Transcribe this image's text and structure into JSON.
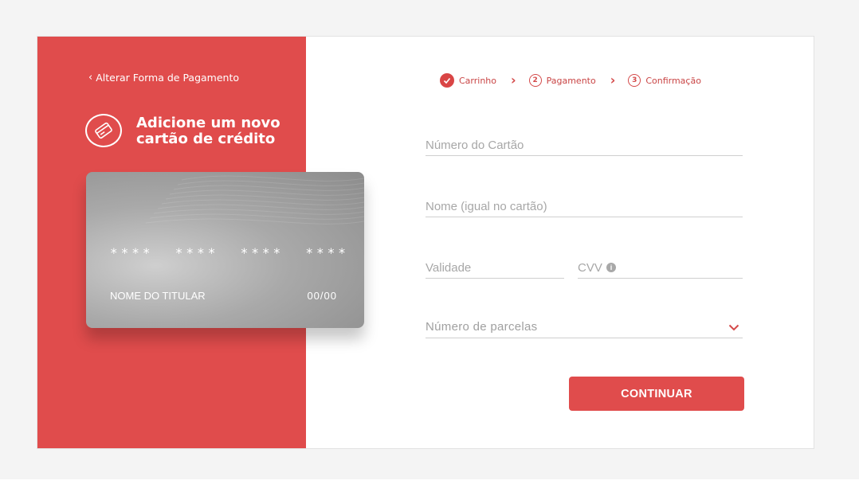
{
  "back_link": {
    "label": "Alterar Forma de Pagamento"
  },
  "header": {
    "title_line1": "Adicione um novo",
    "title_line2": "cartão de crédito"
  },
  "card": {
    "number": "****  ****  ****  ****",
    "holder": "NOME DO TITULAR",
    "expiry": "00/00"
  },
  "steps": [
    {
      "label": "Carrinho",
      "number": "",
      "status": "done"
    },
    {
      "label": "Pagamento",
      "number": "2",
      "status": "current"
    },
    {
      "label": "Confirmação",
      "number": "3",
      "status": "pending"
    }
  ],
  "form": {
    "card_number_placeholder": "Número do Cartão",
    "name_placeholder": "Nome (igual no cartão)",
    "expiry_placeholder": "Validade",
    "cvv_placeholder": "CVV",
    "cvv_info": "i",
    "installments_label": "Número de parcelas"
  },
  "actions": {
    "continue_label": "CONTINUAR"
  },
  "colors": {
    "accent": "#e04c4c",
    "card_gray": "#a9a9a9",
    "muted_text": "#a7a7a7"
  }
}
